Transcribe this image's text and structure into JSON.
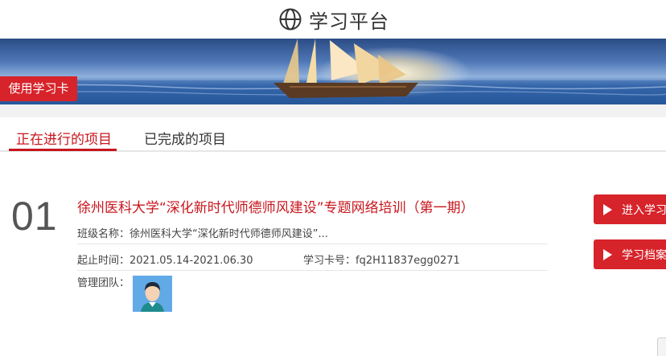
{
  "header": {
    "title": "学习平台",
    "logo_icon": "globe-icon"
  },
  "banner": {
    "card_button_label": "使用学习卡"
  },
  "tabs": [
    {
      "label": "正在进行的项目",
      "active": true
    },
    {
      "label": "已完成的项目",
      "active": false
    }
  ],
  "project": {
    "index": "01",
    "title": "徐州医科大学“深化新时代师德师风建设”专题网络培训（第一期）",
    "class_label": "班级名称：",
    "class_name": "徐州医科大学“深化新时代师德师风建设”...",
    "period_label": "起止时间：",
    "period": "2021.05.14-2021.06.30",
    "card_label": "学习卡号：",
    "card_number": "fq2H11837egg0271",
    "team_label": "管理团队："
  },
  "actions": {
    "enter_label": "进入学习",
    "archive_label": "学习档案"
  },
  "colors": {
    "accent": "#d7232a",
    "title_red": "#c8161d"
  }
}
